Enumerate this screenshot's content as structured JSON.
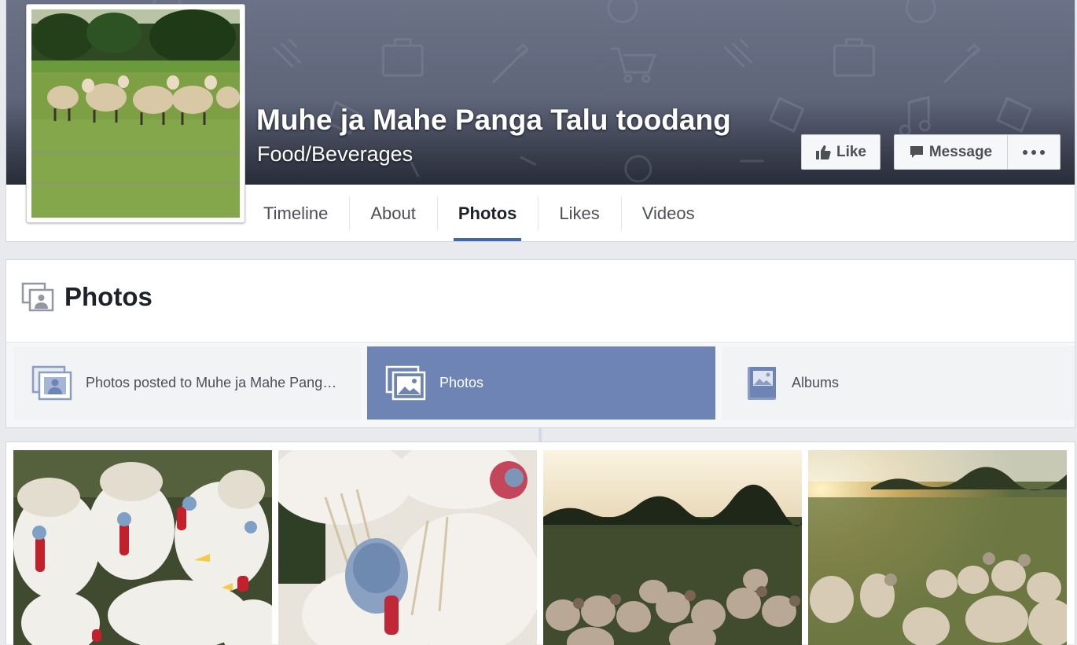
{
  "page": {
    "name": "Muhe ja Mahe Panga Talu toodang",
    "category": "Food/Beverages"
  },
  "actions": {
    "like_label": "Like",
    "message_label": "Message",
    "more_icon": "more-dots-icon"
  },
  "nav": {
    "items": [
      {
        "label": "Timeline"
      },
      {
        "label": "About"
      },
      {
        "label": "Photos",
        "active": true
      },
      {
        "label": "Likes"
      },
      {
        "label": "Videos"
      }
    ]
  },
  "photos_section": {
    "title": "Photos",
    "tabs": [
      {
        "label": "Photos posted to Muhe ja Mahe Panga Talu toodang",
        "icon": "tagged-photos-icon"
      },
      {
        "label": "Photos",
        "icon": "photos-icon",
        "active": true
      },
      {
        "label": "Albums",
        "icon": "album-icon"
      }
    ]
  },
  "colors": {
    "accent": "#4267b2",
    "active_tab": "#6d84b4",
    "cover": "#5e6579"
  }
}
